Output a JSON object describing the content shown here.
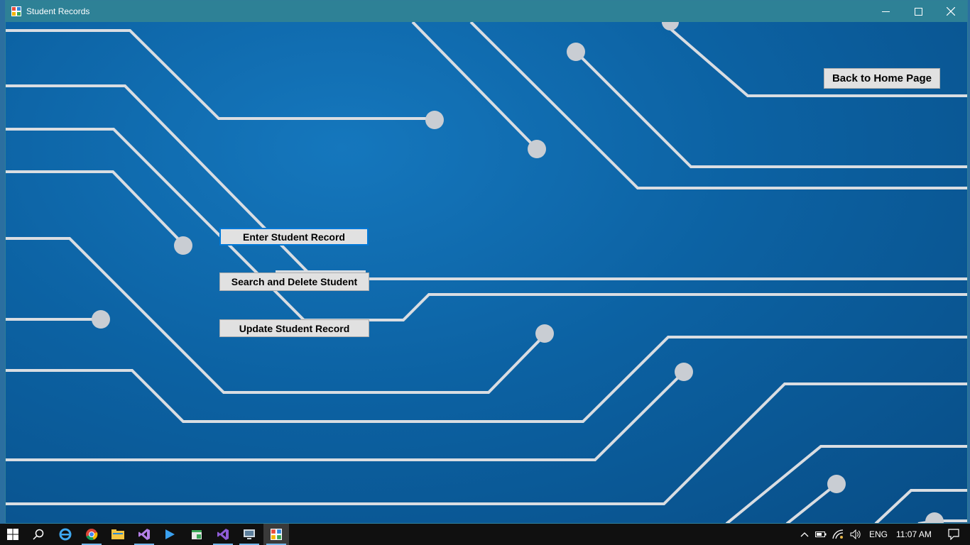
{
  "window": {
    "title": "Student Records"
  },
  "buttons": {
    "back_home": "Back to Home Page",
    "enter_record": "Enter Student Record",
    "search_delete": "Search and Delete Student",
    "update_record": "Update Student Record"
  },
  "taskbar": {
    "items": [
      "start-icon",
      "search-icon",
      "internet-explorer-icon",
      "chrome-icon",
      "file-explorer-icon",
      "visual-studio-icon",
      "media-player-icon",
      "app-icon",
      "visual-studio-icon",
      "network-app-icon",
      "student-records-app-icon"
    ],
    "tray": {
      "language": "ENG",
      "time": "11:07 AM"
    }
  },
  "colors": {
    "titlebar": "#2e8196",
    "background": "#0a5a96",
    "circuit_line": "#d9dde2",
    "button_face": "#e1e1e1",
    "focus_border": "#0078d7"
  }
}
